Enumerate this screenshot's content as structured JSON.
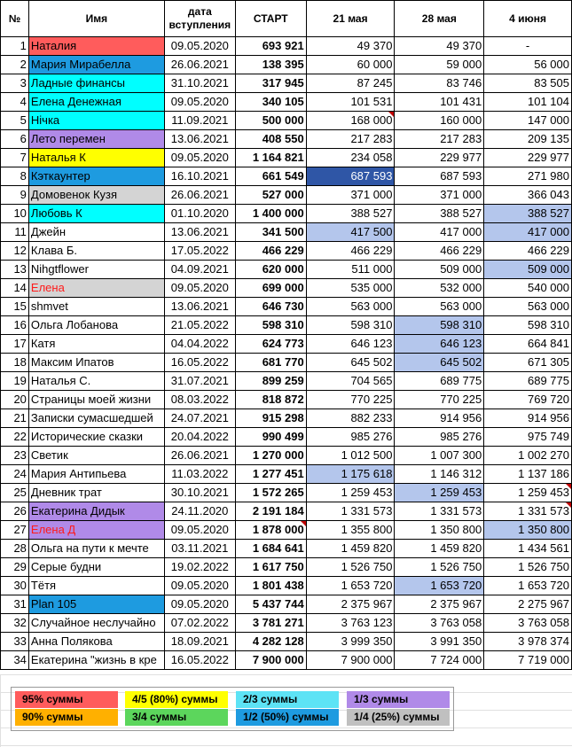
{
  "headers": [
    "№",
    "Имя",
    "дата вступления",
    "СТАРТ",
    "21 мая",
    "28 мая",
    "4 июня"
  ],
  "rows": [
    {
      "n": "1",
      "name": "Наталия",
      "date": "09.05.2020",
      "start": "693 921",
      "m21": "49 370",
      "m28": "49 370",
      "j4": "-"
    },
    {
      "n": "2",
      "name": "Мария Мирабелла",
      "date": "26.06.2021",
      "start": "138 395",
      "m21": "60 000",
      "m28": "59 000",
      "j4": "56 000"
    },
    {
      "n": "3",
      "name": "Ладные финансы",
      "date": "31.10.2021",
      "start": "317 945",
      "m21": "87 245",
      "m28": "83 746",
      "j4": "83 505"
    },
    {
      "n": "4",
      "name": "Елена Денежная",
      "date": "09.05.2020",
      "start": "340 105",
      "m21": "101 531",
      "m28": "101 431",
      "j4": "101 104"
    },
    {
      "n": "5",
      "name": "Нічка",
      "date": "11.09.2021",
      "start": "500 000",
      "m21": "168 000",
      "m28": "160 000",
      "j4": "147 000"
    },
    {
      "n": "6",
      "name": "Лето перемен",
      "date": "13.06.2021",
      "start": "408 550",
      "m21": "217 283",
      "m28": "217 283",
      "j4": "209 135"
    },
    {
      "n": "7",
      "name": "Наталья К",
      "date": "09.05.2020",
      "start": "1 164 821",
      "m21": "234 058",
      "m28": "229 977",
      "j4": "229 977"
    },
    {
      "n": "8",
      "name": "Кэткаунтер",
      "date": "16.10.2021",
      "start": "661 549",
      "m21": "687 593",
      "m28": "687 593",
      "j4": "271 980"
    },
    {
      "n": "9",
      "name": "Домовенок Кузя",
      "date": "26.06.2021",
      "start": "527 000",
      "m21": "371 000",
      "m28": "371 000",
      "j4": "366 043"
    },
    {
      "n": "10",
      "name": "Любовь К",
      "date": "01.10.2020",
      "start": "1 400 000",
      "m21": "388 527",
      "m28": "388 527",
      "j4": "388 527"
    },
    {
      "n": "11",
      "name": "Джейн",
      "date": "13.06.2021",
      "start": "341 500",
      "m21": "417 500",
      "m28": "417 000",
      "j4": "417 000"
    },
    {
      "n": "12",
      "name": "Клава Б.",
      "date": "17.05.2022",
      "start": "466 229",
      "m21": "466 229",
      "m28": "466 229",
      "j4": "466 229"
    },
    {
      "n": "13",
      "name": "Nihgtflower",
      "date": "04.09.2021",
      "start": "620 000",
      "m21": "511 000",
      "m28": "509 000",
      "j4": "509 000"
    },
    {
      "n": "14",
      "name": "Елена",
      "date": "09.05.2020",
      "start": "699 000",
      "m21": "535 000",
      "m28": "532 000",
      "j4": "540 000"
    },
    {
      "n": "15",
      "name": "shmvet",
      "date": "13.06.2021",
      "start": "646 730",
      "m21": "563 000",
      "m28": "563 000",
      "j4": "563 000"
    },
    {
      "n": "16",
      "name": "Ольга Лобанова",
      "date": "21.05.2022",
      "start": "598 310",
      "m21": "598 310",
      "m28": "598 310",
      "j4": "598 310"
    },
    {
      "n": "17",
      "name": "Катя",
      "date": "04.04.2022",
      "start": "624 773",
      "m21": "646 123",
      "m28": "646 123",
      "j4": "664 841"
    },
    {
      "n": "18",
      "name": "Максим Ипатов",
      "date": "16.05.2022",
      "start": "681 770",
      "m21": "645 502",
      "m28": "645 502",
      "j4": "671 305"
    },
    {
      "n": "19",
      "name": "Наталья С.",
      "date": "31.07.2021",
      "start": "899 259",
      "m21": "704 565",
      "m28": "689 775",
      "j4": "689 775"
    },
    {
      "n": "20",
      "name": "Страницы моей жизни",
      "date": "08.03.2022",
      "start": "818 872",
      "m21": "770 225",
      "m28": "770 225",
      "j4": "769 720"
    },
    {
      "n": "21",
      "name": "Записки сумасшедшей",
      "date": "24.07.2021",
      "start": "915 298",
      "m21": "882 233",
      "m28": "914 956",
      "j4": "914 956"
    },
    {
      "n": "22",
      "name": "Исторические сказки",
      "date": "20.04.2022",
      "start": "990 499",
      "m21": "985 276",
      "m28": "985 276",
      "j4": "975 749"
    },
    {
      "n": "23",
      "name": "Светик",
      "date": "26.06.2021",
      "start": "1 270 000",
      "m21": "1 012 500",
      "m28": "1 007 300",
      "j4": "1 002 270"
    },
    {
      "n": "24",
      "name": "Мария Антипьева",
      "date": "11.03.2022",
      "start": "1 277 451",
      "m21": "1 175 618",
      "m28": "1 146 312",
      "j4": "1 137 186"
    },
    {
      "n": "25",
      "name": "Дневник трат",
      "date": "30.10.2021",
      "start": "1 572 265",
      "m21": "1 259 453",
      "m28": "1 259 453",
      "j4": "1 259 453"
    },
    {
      "n": "26",
      "name": "Екатерина Дидык",
      "date": "24.11.2020",
      "start": "2 191 184",
      "m21": "1 331 573",
      "m28": "1 331 573",
      "j4": "1 331 573"
    },
    {
      "n": "27",
      "name": "Елена Д",
      "date": "09.05.2020",
      "start": "1 878 000",
      "m21": "1 355 800",
      "m28": "1 350 800",
      "j4": "1 350 800"
    },
    {
      "n": "28",
      "name": "Ольга на пути к мечте",
      "date": "03.11.2021",
      "start": "1 684 641",
      "m21": "1 459 820",
      "m28": "1 459 820",
      "j4": "1 434 561"
    },
    {
      "n": "29",
      "name": "Серые будни",
      "date": "19.02.2022",
      "start": "1 617 750",
      "m21": "1 526 750",
      "m28": "1 526 750",
      "j4": "1 526 750"
    },
    {
      "n": "30",
      "name": "Тётя",
      "date": "09.05.2020",
      "start": "1 801 438",
      "m21": "1 653 720",
      "m28": "1 653 720",
      "j4": "1 653 720"
    },
    {
      "n": "31",
      "name": "Plan 105",
      "date": "09.05.2020",
      "start": "5 437 744",
      "m21": "2 375 967",
      "m28": "2 375 967",
      "j4": "2 275 967"
    },
    {
      "n": "32",
      "name": "Случайное неслучайно",
      "date": "07.02.2022",
      "start": "3 781 271",
      "m21": "3 763 123",
      "m28": "3 763 058",
      "j4": "3 763 058"
    },
    {
      "n": "33",
      "name": "Анна Полякова",
      "date": "18.09.2021",
      "start": "4 282 128",
      "m21": "3 999 350",
      "m28": "3 991 350",
      "j4": "3 978 374"
    },
    {
      "n": "34",
      "name": "Екатерина \"жизнь в кре",
      "date": "16.05.2022",
      "start": "7 900 000",
      "m21": "7 900 000",
      "m28": "7 724 000",
      "j4": "7 719 000"
    }
  ],
  "name_colors": {
    "1": "#ff5c5c",
    "2": "#1e9be0",
    "3": "#00ffff",
    "4": "#00ffff",
    "5": "#00ffff",
    "6": "#b08ae8",
    "7": "#ffff00",
    "8": "#1e9be0",
    "9": "#d4d4d4",
    "10": "#00ffff",
    "14": "#d4d4d4",
    "26": "#b08ae8",
    "27": "#b08ae8",
    "31": "#1e9be0"
  },
  "red_text_rows": [
    "14",
    "27"
  ],
  "highlights": {
    "8.m21": "#2f56a6",
    "10.j4": "#b4c6ec",
    "11.m21": "#b4c6ec",
    "11.j4": "#b4c6ec",
    "13.j4": "#b4c6ec",
    "16.m28": "#b4c6ec",
    "17.m28": "#b4c6ec",
    "18.m28": "#b4c6ec",
    "24.m21": "#b4c6ec",
    "25.m28": "#b4c6ec",
    "27.j4": "#b4c6ec",
    "30.m28": "#b4c6ec"
  },
  "corner_marks": [
    "5.m21",
    "25.j4",
    "26.j4",
    "27.start"
  ],
  "legend": [
    {
      "label": "95% суммы",
      "color": "#ff5c5c"
    },
    {
      "label": "4/5 (80%) суммы",
      "color": "#ffff00"
    },
    {
      "label": "2/3 суммы",
      "color": "#5de3f5"
    },
    {
      "label": "1/3 суммы",
      "color": "#b08ae8"
    },
    {
      "label": "90% суммы",
      "color": "#ffb000"
    },
    {
      "label": "3/4 суммы",
      "color": "#5cd65c"
    },
    {
      "label": "1/2 (50%) суммы",
      "color": "#1e9be0"
    },
    {
      "label": "1/4 (25%) суммы",
      "color": "#c0c0c0"
    }
  ]
}
